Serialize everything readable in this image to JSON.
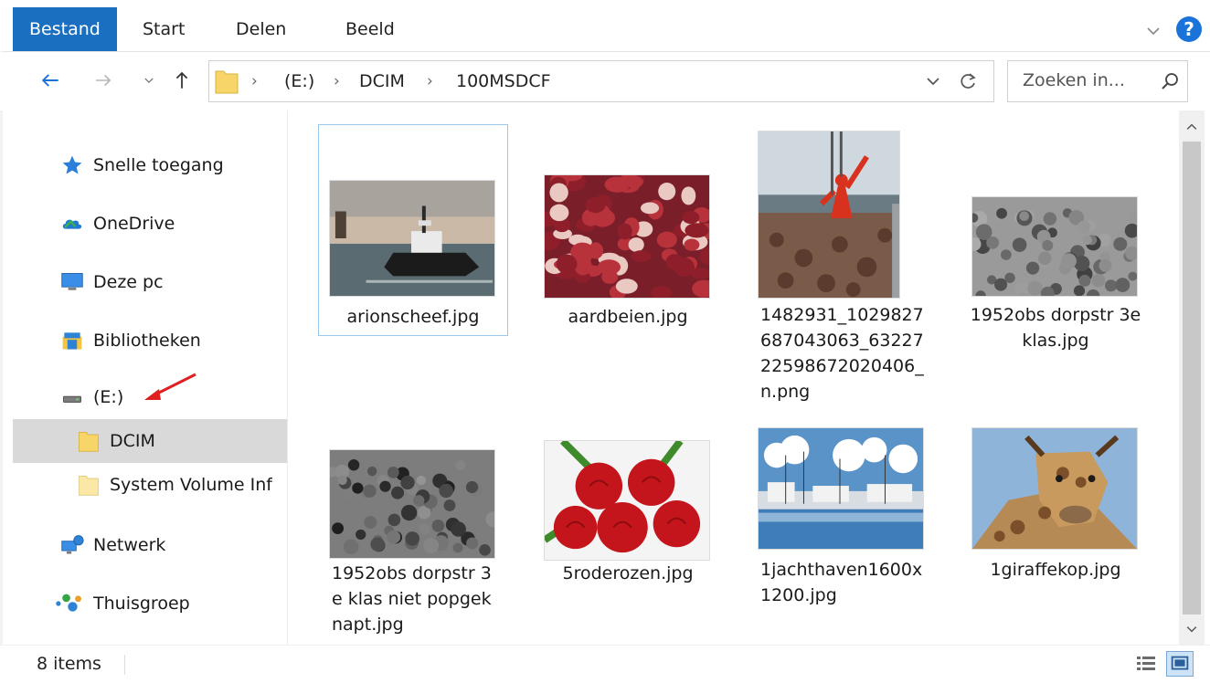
{
  "ribbon": {
    "tabs": [
      {
        "label": "Bestand",
        "active": true
      },
      {
        "label": "Start",
        "active": false
      },
      {
        "label": "Delen",
        "active": false
      },
      {
        "label": "Beeld",
        "active": false
      }
    ],
    "help": "?"
  },
  "address": {
    "crumbs": [
      "(E:)",
      "DCIM",
      "100MSDCF"
    ],
    "separator": "›"
  },
  "search": {
    "placeholder": "Zoeken in..."
  },
  "sidebar": {
    "items": [
      {
        "label": "Snelle toegang",
        "icon": "star-icon"
      },
      {
        "label": "OneDrive",
        "icon": "cloud-icon"
      },
      {
        "label": "Deze pc",
        "icon": "monitor-icon"
      },
      {
        "label": "Bibliotheken",
        "icon": "library-icon"
      },
      {
        "label": "(E:)",
        "icon": "drive-icon"
      },
      {
        "label": "DCIM",
        "icon": "folder-icon",
        "selected": true
      },
      {
        "label": "System Volume Inf",
        "icon": "folder-icon"
      },
      {
        "label": "Netwerk",
        "icon": "network-icon"
      },
      {
        "label": "Thuisgroep",
        "icon": "homegroup-icon"
      }
    ]
  },
  "files": [
    {
      "name": "arionscheef.jpg",
      "thumb": "ship"
    },
    {
      "name": "aardbeien.jpg",
      "thumb": "strawberries"
    },
    {
      "name": "1482931_1029827687043063_6322722598672020406_n.png",
      "thumb": "fisherman"
    },
    {
      "name": "1952obs dorpstr 3e klas.jpg",
      "thumb": "class-photo"
    },
    {
      "name": "1952obs dorpstr 3e klas niet popgeknapt.jpg",
      "thumb": "class-photo-2"
    },
    {
      "name": "5roderozen.jpg",
      "thumb": "roses"
    },
    {
      "name": "1jachthaven1600x1200.jpg",
      "thumb": "harbor"
    },
    {
      "name": "1giraffekop.jpg",
      "thumb": "giraffe"
    }
  ],
  "status": {
    "count": "8 items"
  },
  "colors": {
    "accent": "#1a6fc1",
    "selection": "#d9d9d9",
    "tileSelectionBorder": "#99c9ef",
    "annotationArrow": "#e02020"
  }
}
